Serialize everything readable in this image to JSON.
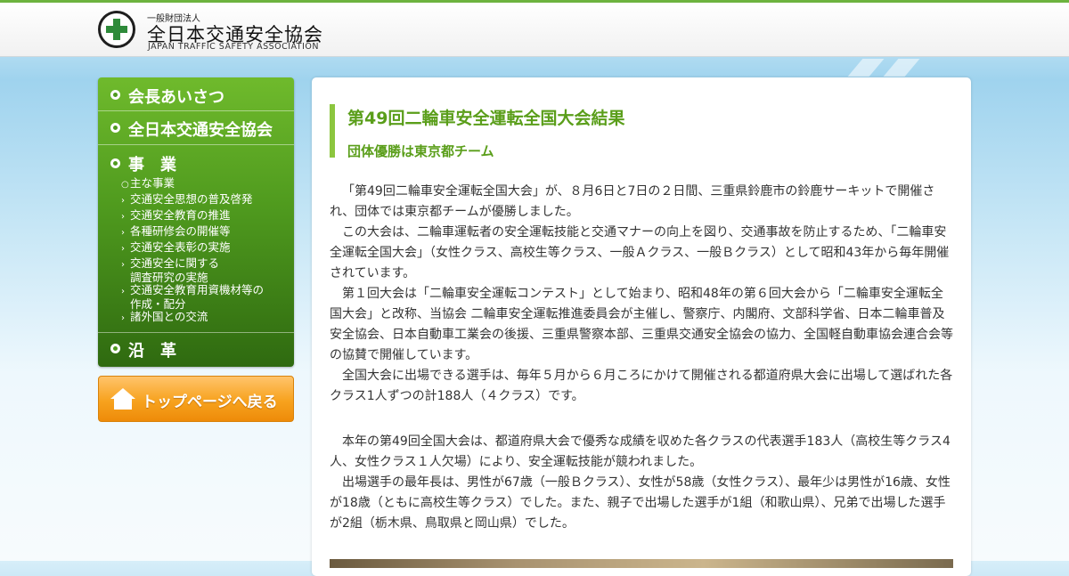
{
  "header": {
    "logo_small": "一般財団法人",
    "logo_name": "全日本交通安全協会",
    "logo_en": "JAPAN TRAFFIC SAFETY ASSOCIATION"
  },
  "sidebar": {
    "items": [
      {
        "label": "会長あいさつ"
      },
      {
        "label": "全日本交通安全協会"
      },
      {
        "label": "事　業"
      },
      {
        "label": "沿　革"
      }
    ],
    "subitems": [
      {
        "mark": "○",
        "label": "主な事業"
      },
      {
        "mark": "›",
        "label": "交通安全思想の普及啓発"
      },
      {
        "mark": "›",
        "label": "交通安全教育の推進"
      },
      {
        "mark": "›",
        "label": "各種研修会の開催等"
      },
      {
        "mark": "›",
        "label": "交通安全表彰の実施"
      },
      {
        "mark": "›",
        "label": "交通安全に関する",
        "label2": "調査研究の実施"
      },
      {
        "mark": "›",
        "label": "交通安全教育用資機材等の",
        "label2": "作成・配分"
      },
      {
        "mark": "›",
        "label": "諸外国との交流"
      }
    ],
    "top_button": "トップページへ戻る"
  },
  "main": {
    "title": "第49回二輪車安全運転全国大会結果",
    "subtitle": "団体優勝は東京都チーム",
    "paragraphs": [
      "「第49回二輪車安全運転全国大会」が、８月6日と7日の２日間、三重県鈴鹿市の鈴鹿サーキットで開催され、団体では東京都チームが優勝しました。",
      "この大会は、二輪車運転者の安全運転技能と交通マナーの向上を図り、交通事故を防止するため、「二輪車安全運転全国大会」（女性クラス、高校生等クラス、一般Ａクラス、一般Ｂクラス）として昭和43年から毎年開催されています。",
      "第１回大会は「二輪車安全運転コンテスト」として始まり、昭和48年の第６回大会から「二輪車安全運転全国大会」と改称、当協会 二輪車安全運転推進委員会が主催し、警察庁、内閣府、文部科学省、日本二輪車普及安全協会、日本自動車工業会の後援、三重県警察本部、三重県交通安全協会の協力、全国軽自動車協会連合会等の協賛で開催しています。",
      "全国大会に出場できる選手は、毎年５月から６月ころにかけて開催される都道府県大会に出場して選ばれた各クラス1人ずつの計188人（４クラス）です。",
      "本年の第49回全国大会は、都道府県大会で優秀な成績を収めた各クラスの代表選手183人（高校生等クラス4人、女性クラス１人欠場）により、安全運転技能が競われました。",
      "出場選手の最年長は、男性が67歳（一般Ｂクラス）、女性が58歳（女性クラス）、最年少は男性が16歳、女性が18歳（ともに高校生等クラス）でした。また、親子で出場した選手が1組（和歌山県）、兄弟で出場した選手が2組（栃木県、鳥取県と岡山県）でした。"
    ]
  },
  "colors": {
    "accent_green": "#5a9e1a",
    "sidebar_green": "#4f9a1e",
    "button_orange": "#f7a21e"
  }
}
